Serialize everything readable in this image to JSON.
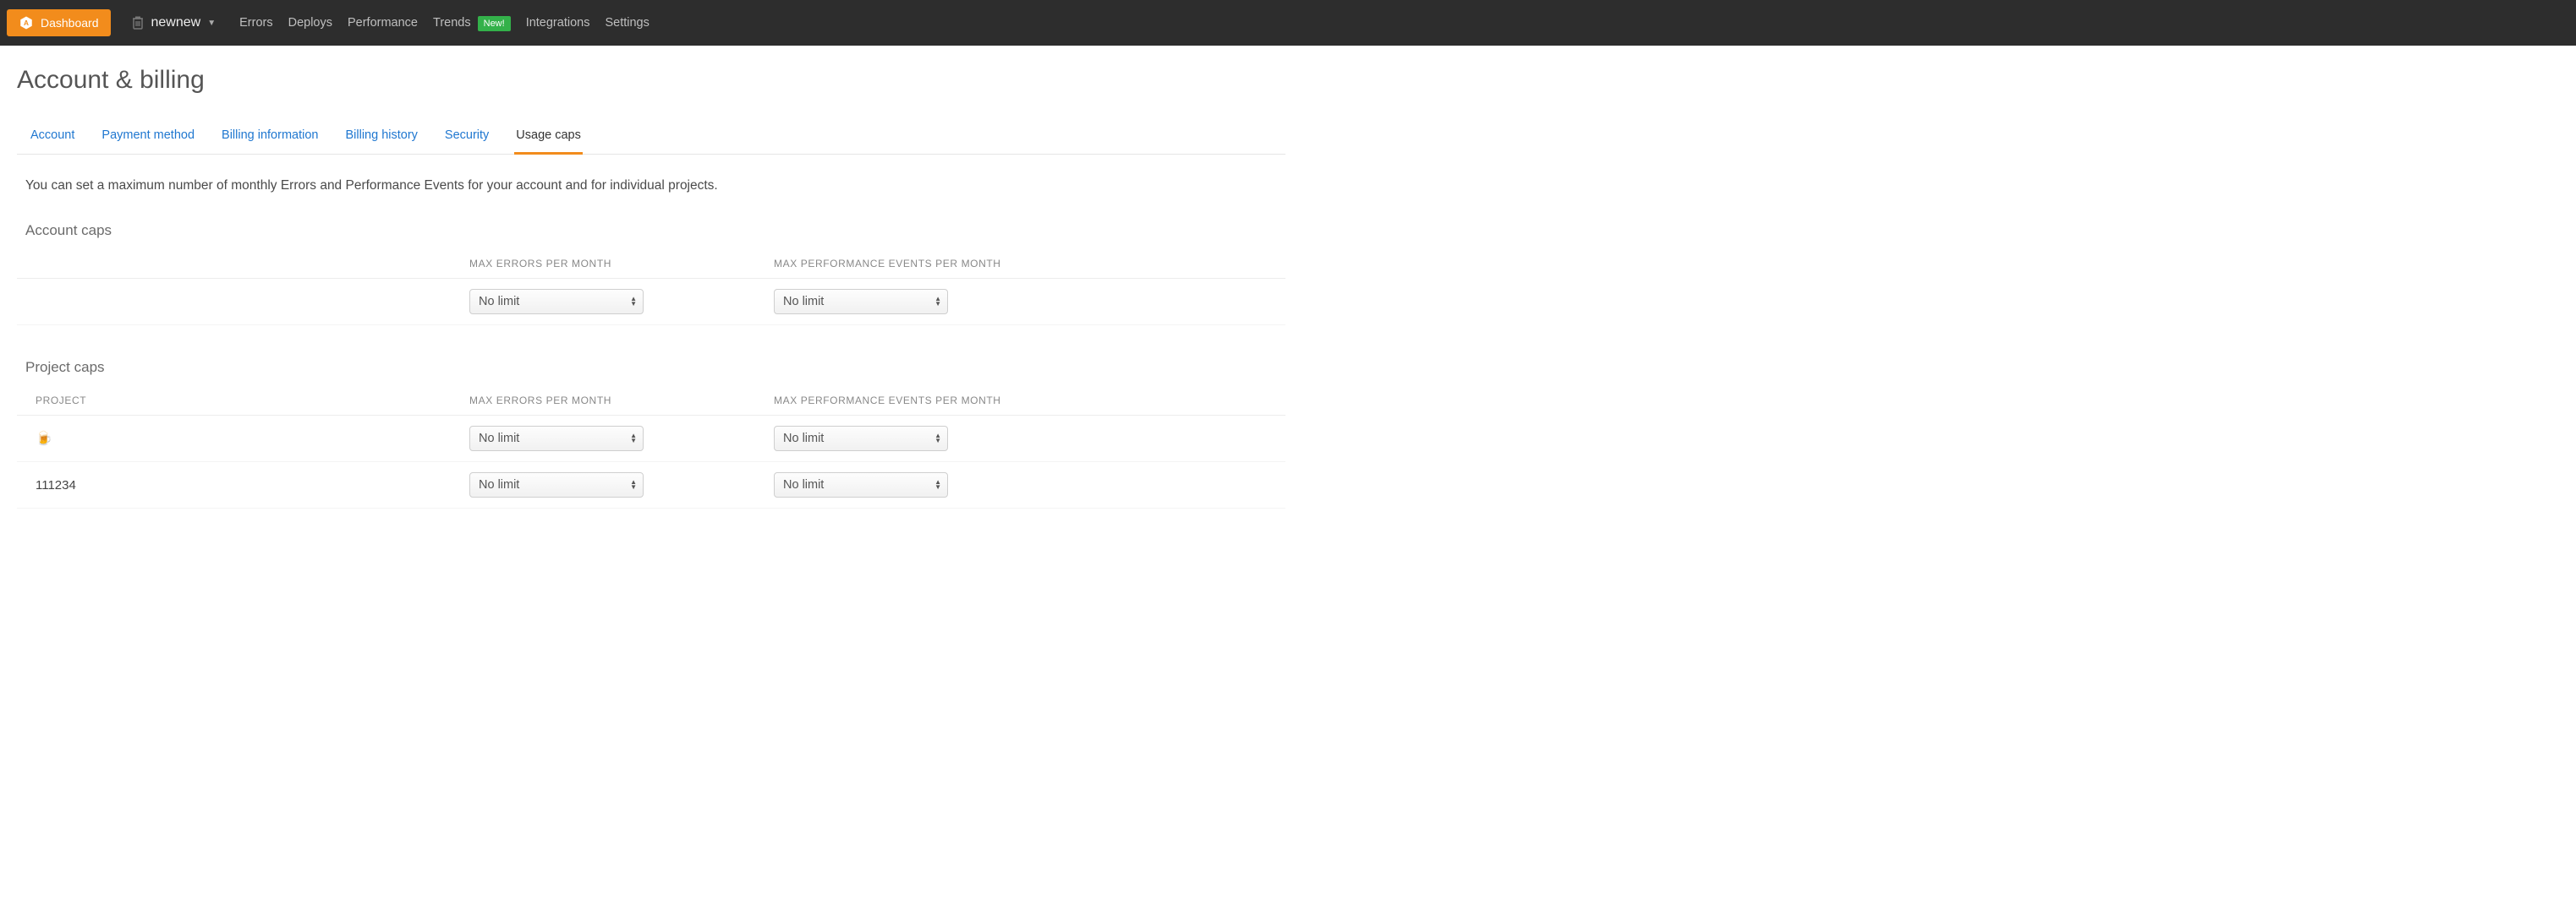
{
  "topbar": {
    "dashboard_label": "Dashboard",
    "project_name": "newnew",
    "nav": {
      "errors": "Errors",
      "deploys": "Deploys",
      "performance": "Performance",
      "trends": "Trends",
      "new_badge": "New!",
      "integrations": "Integrations",
      "settings": "Settings"
    }
  },
  "page_title": "Account & billing",
  "tabs": [
    {
      "label": "Account",
      "active": false
    },
    {
      "label": "Payment method",
      "active": false
    },
    {
      "label": "Billing information",
      "active": false
    },
    {
      "label": "Billing history",
      "active": false
    },
    {
      "label": "Security",
      "active": false
    },
    {
      "label": "Usage caps",
      "active": true
    }
  ],
  "intro_text": "You can set a maximum number of monthly Errors and Performance Events for your account and for individual projects.",
  "sections": {
    "account": {
      "heading": "Account caps",
      "headers": {
        "errors": "MAX ERRORS PER MONTH",
        "perf": "MAX PERFORMANCE EVENTS PER MONTH"
      },
      "row": {
        "errors_value": "No limit",
        "perf_value": "No limit"
      }
    },
    "project": {
      "heading": "Project caps",
      "headers": {
        "project": "PROJECT",
        "errors": "MAX ERRORS PER MONTH",
        "perf": "MAX PERFORMANCE EVENTS PER MONTH"
      },
      "rows": [
        {
          "name": "🍺",
          "errors_value": "No limit",
          "perf_value": "No limit"
        },
        {
          "name": "111234",
          "errors_value": "No limit",
          "perf_value": "No limit"
        }
      ]
    }
  },
  "select_options": [
    "No limit"
  ]
}
